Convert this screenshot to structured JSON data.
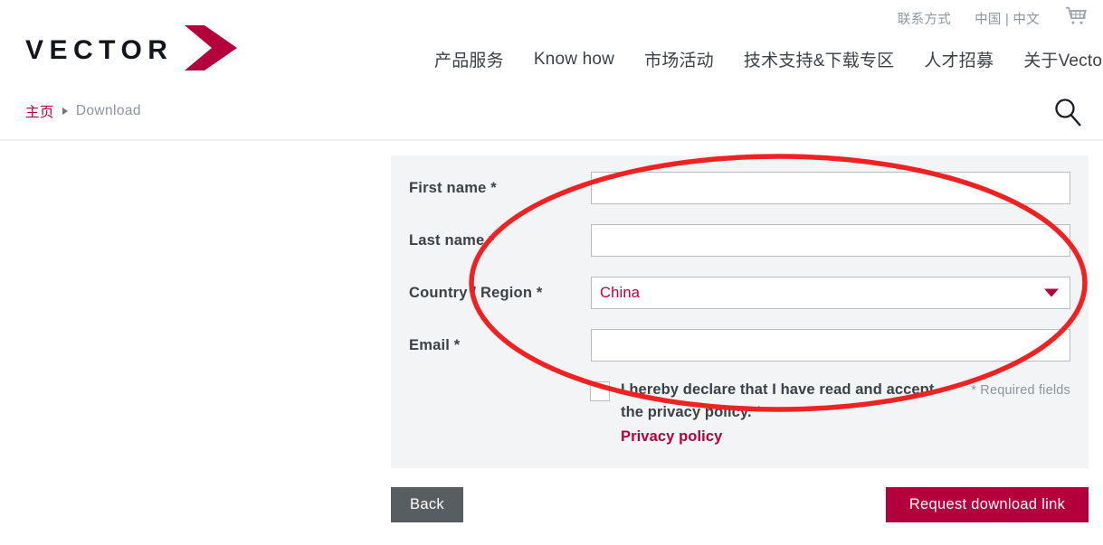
{
  "topbar": {
    "contact_label": "联系方式",
    "locale_label": "中国 | 中文",
    "cart_icon": "shopping-cart-icon"
  },
  "logo": {
    "wordmark": "VECTOR",
    "arrow_icon": "vector-arrow-icon",
    "arrow_color": "#b3003c"
  },
  "nav": {
    "items": [
      {
        "label": "产品服务"
      },
      {
        "label": "Know how"
      },
      {
        "label": "市场活动"
      },
      {
        "label": "技术支持&下载专区"
      },
      {
        "label": "人才招募"
      },
      {
        "label": "关于Vector"
      }
    ]
  },
  "breadcrumb": {
    "home": "主页",
    "separator_icon": "triangle-right-icon",
    "current": "Download"
  },
  "search": {
    "icon": "search-icon"
  },
  "form": {
    "fields": [
      {
        "label": "First name *",
        "type": "text",
        "value": "",
        "placeholder": ""
      },
      {
        "label": "Last name *",
        "type": "text",
        "value": "",
        "placeholder": ""
      },
      {
        "label": "Country / Region *",
        "type": "select",
        "value": "China",
        "caret_icon": "chevron-down-icon"
      },
      {
        "label": "Email *",
        "type": "text",
        "value": "",
        "placeholder": ""
      }
    ],
    "consent": {
      "checked": false,
      "text": "I hereby declare that I have read and accept the privacy policy. *",
      "link_label": "Privacy policy"
    },
    "required_note": "* Required fields"
  },
  "actions": {
    "back_label": "Back",
    "submit_label": "Request download link"
  },
  "annotation": {
    "shape": "ellipse-highlight",
    "color": "#ee2222"
  },
  "colors": {
    "brand": "#b3003c",
    "panel_bg": "#f2f4f6",
    "text": "#3c4147",
    "muted": "#8d949c",
    "annotation": "#ee2222"
  }
}
